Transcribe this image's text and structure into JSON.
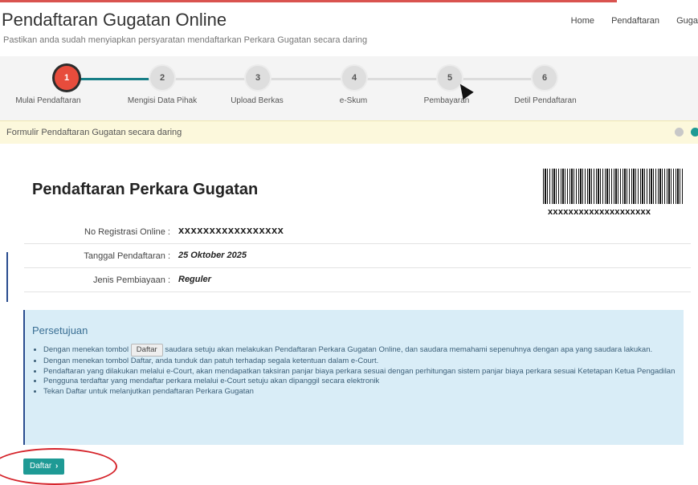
{
  "header": {
    "title": "Pendaftaran Gugatan Online",
    "subtitle": "Pastikan anda sudah menyiapkan persyaratan mendaftarkan Perkara Gugatan secara daring",
    "nav": [
      "Home",
      "Pendaftaran",
      "Guga"
    ]
  },
  "wizard": {
    "current_step": 1,
    "steps": [
      {
        "number": "1",
        "label": "Mulai Pendaftaran"
      },
      {
        "number": "2",
        "label": "Mengisi Data Pihak"
      },
      {
        "number": "3",
        "label": "Upload Berkas"
      },
      {
        "number": "4",
        "label": "e-Skum"
      },
      {
        "number": "5",
        "label": "Pembayaran"
      },
      {
        "number": "6",
        "label": "Detil Pendaftaran"
      }
    ]
  },
  "notice": {
    "text": "Formulir Pendaftaran Gugatan secara daring"
  },
  "registration": {
    "title": "Pendaftaran Perkara Gugatan",
    "barcode_text": "xxxxxxxxxxxxxxxxxxxx",
    "rows": [
      {
        "label": "No Registrasi Online :",
        "value": "xxxxxxxxxxxxxxxxx"
      },
      {
        "label": "Tanggal Pendaftaran :",
        "value": "25 Oktober 2025"
      },
      {
        "label": "Jenis Pembiayaan :",
        "value": "Reguler"
      }
    ]
  },
  "agreement": {
    "title": "Persetujuan",
    "item1_pre": "Dengan menekan tombol",
    "item1_button": "Daftar",
    "item1_post": "saudara setuju akan melakukan Pendaftaran Perkara Gugatan Online, dan saudara memahami sepenuhnya dengan apa yang saudara lakukan.",
    "items": [
      "Dengan menekan tombol Daftar, anda tunduk dan patuh terhadap segala ketentuan dalam e-Court.",
      "Pendaftaran yang dilakukan melalui e-Court, akan mendapatkan taksiran panjar biaya perkara sesuai dengan perhitungan sistem panjar biaya perkara sesuai Ketetapan Ketua Pengadilan",
      "Pengguna terdaftar yang mendaftar perkara melalui e-Court setuju akan dipanggil secara elektronik",
      "Tekan Daftar untuk melanjutkan pendaftaran Perkara Gugatan"
    ]
  },
  "submit": {
    "label": "Daftar",
    "icon": "chevron-right-icon"
  },
  "colors": {
    "accent": "#1e9a95",
    "active_step": "#e74c3c",
    "progress": "#177e86",
    "notice_bg": "#fcf8dc",
    "agreement_bg": "#d9edf7",
    "annotation": "#d5232a"
  }
}
